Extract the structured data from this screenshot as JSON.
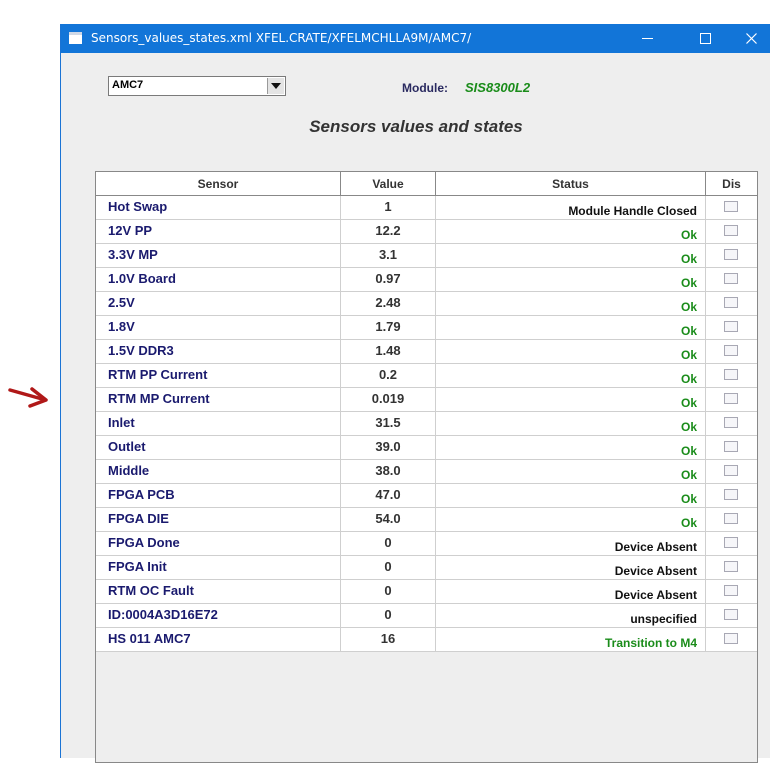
{
  "window": {
    "title": "Sensors_values_states.xml   XFEL.CRATE/XFELMCHLLA9M/AMC7/"
  },
  "selector": {
    "value": "AMC7"
  },
  "module": {
    "label": "Module:",
    "value": "SIS8300L2"
  },
  "heading": "Sensors values and states",
  "table": {
    "columns": {
      "sensor": "Sensor",
      "value": "Value",
      "status": "Status",
      "dis": "Dis"
    },
    "rows": [
      {
        "sensor": "Hot Swap",
        "value": "1",
        "status": "Module Handle Closed",
        "status_color": "black"
      },
      {
        "sensor": "12V PP",
        "value": "12.2",
        "status": "Ok",
        "status_color": "green"
      },
      {
        "sensor": "3.3V MP",
        "value": "3.1",
        "status": "Ok",
        "status_color": "green"
      },
      {
        "sensor": "1.0V Board",
        "value": "0.97",
        "status": "Ok",
        "status_color": "green"
      },
      {
        "sensor": "2.5V",
        "value": "2.48",
        "status": "Ok",
        "status_color": "green"
      },
      {
        "sensor": "1.8V",
        "value": "1.79",
        "status": "Ok",
        "status_color": "green"
      },
      {
        "sensor": "1.5V DDR3",
        "value": "1.48",
        "status": "Ok",
        "status_color": "green"
      },
      {
        "sensor": "RTM PP Current",
        "value": "0.2",
        "status": "Ok",
        "status_color": "green"
      },
      {
        "sensor": "RTM MP Current",
        "value": "0.019",
        "status": "Ok",
        "status_color": "green"
      },
      {
        "sensor": "Inlet",
        "value": "31.5",
        "status": "Ok",
        "status_color": "green"
      },
      {
        "sensor": "Outlet",
        "value": "39.0",
        "status": "Ok",
        "status_color": "green"
      },
      {
        "sensor": "Middle",
        "value": "38.0",
        "status": "Ok",
        "status_color": "green"
      },
      {
        "sensor": "FPGA PCB",
        "value": "47.0",
        "status": "Ok",
        "status_color": "green"
      },
      {
        "sensor": "FPGA DIE",
        "value": "54.0",
        "status": "Ok",
        "status_color": "green"
      },
      {
        "sensor": "FPGA Done",
        "value": "0",
        "status": "Device Absent",
        "status_color": "black"
      },
      {
        "sensor": "FPGA Init",
        "value": "0",
        "status": "Device Absent",
        "status_color": "black"
      },
      {
        "sensor": "RTM OC Fault",
        "value": "0",
        "status": "Device Absent",
        "status_color": "black"
      },
      {
        "sensor": "ID:0004A3D16E72",
        "value": "0",
        "status": "unspecified",
        "status_color": "black"
      },
      {
        "sensor": "HS 011 AMC7",
        "value": "16",
        "status": "Transition to M4",
        "status_color": "green"
      }
    ]
  },
  "colors": {
    "titlebar": "#1275d8",
    "status_ok": "#1a8c1a",
    "sensor_text": "#1a1a6e",
    "annotation_arrow": "#b01818"
  }
}
